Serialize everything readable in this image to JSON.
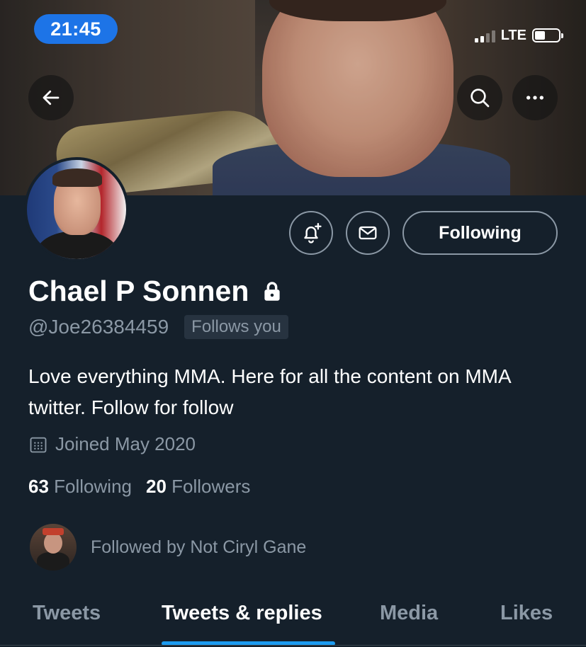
{
  "status_bar": {
    "time": "21:45",
    "network": "LTE"
  },
  "banner": {
    "back_icon": "arrow-left-icon",
    "search_icon": "search-icon",
    "more_icon": "more-horizontal-icon"
  },
  "profile": {
    "name": "Chael P Sonnen",
    "protected_icon": "lock-icon",
    "handle": "@Joe26384459",
    "follows_you": "Follows you",
    "bio": "Love everything MMA. Here for all the content on MMA twitter. Follow for follow",
    "joined": "Joined May 2020",
    "following_count": "63",
    "following_label": "Following",
    "followers_count": "20",
    "followers_label": "Followers",
    "followed_by": "Followed by Not Ciryl Gane"
  },
  "actions": {
    "notify_icon": "bell-plus-icon",
    "message_icon": "mail-icon",
    "follow_label": "Following"
  },
  "tabs": [
    {
      "label": "Tweets",
      "active": false
    },
    {
      "label": "Tweets & replies",
      "active": true
    },
    {
      "label": "Media",
      "active": false
    },
    {
      "label": "Likes",
      "active": false
    }
  ],
  "colors": {
    "background": "#15202b",
    "accent": "#1d9bf0",
    "time_pill": "#1d74e7",
    "secondary_text": "#8b98a5"
  }
}
